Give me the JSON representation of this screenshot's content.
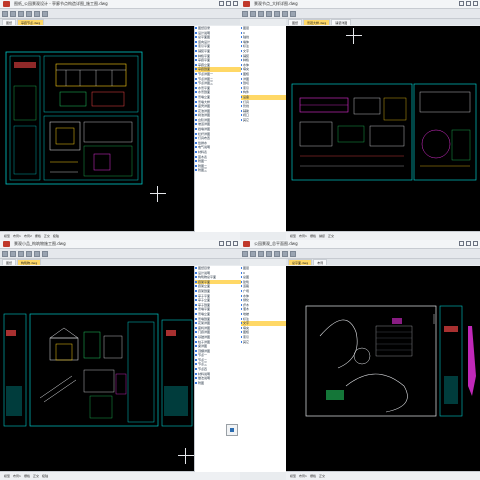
{
  "windows": [
    {
      "id": "top-left",
      "title": "图纸_公园景观设计 - 亭廊节点构造详图_施工图.dwg",
      "tabs": [
        "图纸",
        "亭廊节点.dwg"
      ],
      "status": [
        "模型",
        "布局1",
        "布局2",
        "栅格",
        "正交",
        "极轴"
      ]
    },
    {
      "id": "top-right",
      "title": "景观节点_大样详图.dwg",
      "tabs": [
        "图纸",
        "景观大样.dwg",
        "铺装详图"
      ],
      "status": [
        "模型",
        "布局1",
        "栅格",
        "捕捉",
        "正交"
      ]
    },
    {
      "id": "bottom-left",
      "title": "景观小品_构筑物施工图.dwg",
      "tabs": [
        "图纸",
        "构筑物.dwg"
      ],
      "status": [
        "模型",
        "布局1",
        "栅格",
        "正交",
        "极轴"
      ]
    },
    {
      "id": "bottom-right",
      "title": "公园景观_总平面图.dwg",
      "tabs": [
        "总平面.dwg",
        "布局"
      ],
      "status": [
        "模型",
        "布局1",
        "栅格",
        "正交"
      ]
    }
  ],
  "sidebar_right_top": {
    "items": [
      "图纸目录",
      "设计说明",
      "总平面图",
      "竖向设计",
      "索引平面",
      "铺装平面",
      "种植平面",
      "亭廊平面",
      "亭廊立面",
      "亭廊剖面",
      "节点详图一",
      "节点详图二",
      "节点详图三",
      "水景平面",
      "水景剖面",
      "景墙立面",
      "景墙大样",
      "座凳详图",
      "花池详图",
      "树池详图",
      "台阶详图",
      "坡道详图",
      "挡墙详图",
      "栏杆详图",
      "灯具布置",
      "给排水",
      "电气说明",
      "材料表",
      "苗木表",
      "附图一",
      "附图二",
      "附图三"
    ],
    "selected_index": 9
  },
  "sidebar_left_top_right": {
    "items": [
      "图层",
      "0",
      "轴线",
      "墙体",
      "标注",
      "文字",
      "铺装",
      "种植",
      "水体",
      "填充",
      "图框",
      "详图",
      "剖切",
      "索引",
      "构件",
      "设备",
      "灯具",
      "管线",
      "辅助",
      "视口",
      "其它"
    ],
    "selected_index": 15
  },
  "sidebar_right_bottom": {
    "items": [
      "图纸目录",
      "设计说明",
      "构筑物总平面",
      "廊架平面",
      "廊架立面",
      "廊架剖面",
      "亭子平面",
      "亭子立面",
      "亭子剖面",
      "景墙平面",
      "景墙立面",
      "景墙剖面",
      "花架详图",
      "座椅详图",
      "门廊详图",
      "基础详图",
      "柱子详图",
      "梁详图",
      "顶棚详图",
      "节点一",
      "节点二",
      "节点三",
      "节点四",
      "材料说明",
      "做法说明",
      "附图"
    ],
    "selected_index": 3
  },
  "sidebar_left_bottom_right": {
    "items": [
      "图层",
      "0",
      "总图",
      "建筑",
      "道路",
      "广场",
      "水体",
      "绿化",
      "乔木",
      "灌木",
      "地被",
      "标注",
      "文字",
      "填充",
      "图框",
      "索引",
      "其它"
    ],
    "selected_index": 12
  },
  "colors": {
    "cad_background": "#000000",
    "frame_cyan": "#00c8c8",
    "line_white": "#e5e7eb",
    "line_green": "#22c55e",
    "line_magenta": "#e22fd8",
    "line_yellow": "#facc15",
    "line_red": "#ef4444",
    "tab_active": "#ffd866"
  },
  "icons": [
    "app-icon",
    "minimize-icon",
    "maximize-icon",
    "close-icon",
    "toolbar-icon",
    "crosshair-icon",
    "view-cube-icon"
  ]
}
